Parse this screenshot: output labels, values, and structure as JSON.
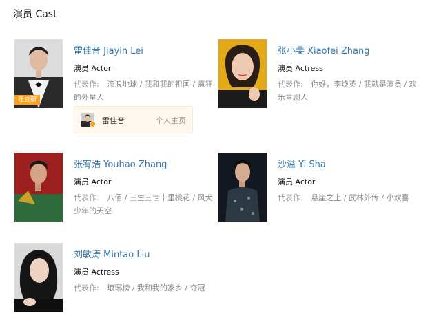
{
  "section": {
    "title": "演员 Cast"
  },
  "cast": [
    {
      "name": "雷佳音 Jiayin Lei",
      "role": "演员 Actor",
      "works_label": "代表作:",
      "works": "流浪地球 / 我和我的祖国 / 疯狂的外星人",
      "badge": "在豆瓣",
      "homepage": {
        "name": "雷佳音",
        "link": "个人主页"
      }
    },
    {
      "name": "张小斐 Xiaofei Zhang",
      "role": "演员 Actress",
      "works_label": "代表作:",
      "works": "你好，李焕英 / 我就是演员 / 欢乐喜剧人"
    },
    {
      "name": "张宥浩 Youhao Zhang",
      "role": "演员 Actor",
      "works_label": "代表作:",
      "works": "八佰 / 三生三世十里桃花 / 风犬少年的天空"
    },
    {
      "name": "沙溢 Yi Sha",
      "role": "演员 Actor",
      "works_label": "代表作:",
      "works": "悬崖之上 / 武林外传 / 小欢喜"
    },
    {
      "name": "刘敏涛 Mintao Liu",
      "role": "演员 Actress",
      "works_label": "代表作:",
      "works": "琅琊榜 / 我和我的家乡 / 夺冠"
    }
  ],
  "colors": {
    "link": "#3377aa",
    "badge": "#ff9f1c",
    "homepage_bg": "#fff8ee"
  }
}
